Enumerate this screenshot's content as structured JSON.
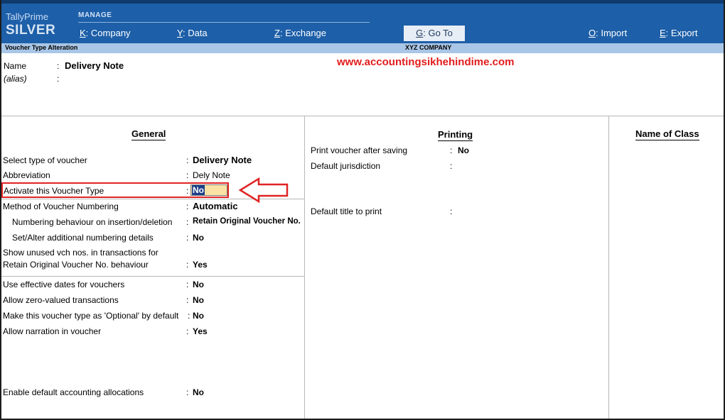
{
  "app": {
    "brand_line1": "TallyPrime",
    "brand_line2": "SILVER",
    "manage_label": "MANAGE"
  },
  "menu": {
    "company": {
      "key": "K",
      "label": "Company"
    },
    "data": {
      "key": "Y",
      "label": "Data"
    },
    "exchange": {
      "key": "Z",
      "label": "Exchange"
    },
    "goto": {
      "key": "G",
      "label": "Go To"
    },
    "import": {
      "key": "O",
      "label": "Import"
    },
    "export": {
      "key": "E",
      "label": "Export"
    }
  },
  "subheader": {
    "screen_title": "Voucher Type Alteration",
    "company": "XYZ COMPANY"
  },
  "watermark": "www.accountingsikhehindime.com",
  "header_fields": {
    "name_label": "Name",
    "name_value": "Delivery Note",
    "alias_label": "(alias)",
    "alias_value": ""
  },
  "general": {
    "title": "General",
    "select_type_label": "Select type of voucher",
    "select_type_value": "Delivery Note",
    "abbreviation_label": "Abbreviation",
    "abbreviation_value": "Dely Note",
    "activate_label": "Activate this Voucher Type",
    "activate_value": "No",
    "numbering_method_label": "Method of Voucher Numbering",
    "numbering_method_value": "Automatic",
    "numbering_behaviour_label": "Numbering behaviour on insertion/deletion",
    "numbering_behaviour_value": "Retain Original Voucher No.",
    "additional_numbering_label": "Set/Alter additional numbering details",
    "additional_numbering_value": "No",
    "show_unused_label_1": "Show unused vch nos. in transactions for",
    "show_unused_label_2": "Retain Original Voucher No. behaviour",
    "show_unused_value": "Yes",
    "effective_dates_label": "Use effective dates for vouchers",
    "effective_dates_value": "No",
    "zero_valued_label": "Allow zero-valued transactions",
    "zero_valued_value": "No",
    "optional_label": "Make this voucher type as 'Optional' by default",
    "optional_value": "No",
    "narration_label": "Allow narration in voucher",
    "narration_value": "Yes",
    "default_alloc_label": "Enable default accounting allocations",
    "default_alloc_value": "No"
  },
  "printing": {
    "title": "Printing",
    "print_after_saving_label": "Print voucher after saving",
    "print_after_saving_value": "No",
    "jurisdiction_label": "Default jurisdiction",
    "jurisdiction_value": "",
    "default_title_label": "Default title to print",
    "default_title_value": ""
  },
  "name_of_class": {
    "title": "Name of Class"
  },
  "colors": {
    "menu_bg": "#1d5fa8",
    "subbar_bg": "#a9c6e6",
    "highlight": "#e02424",
    "watermark": "#e21c1c"
  }
}
